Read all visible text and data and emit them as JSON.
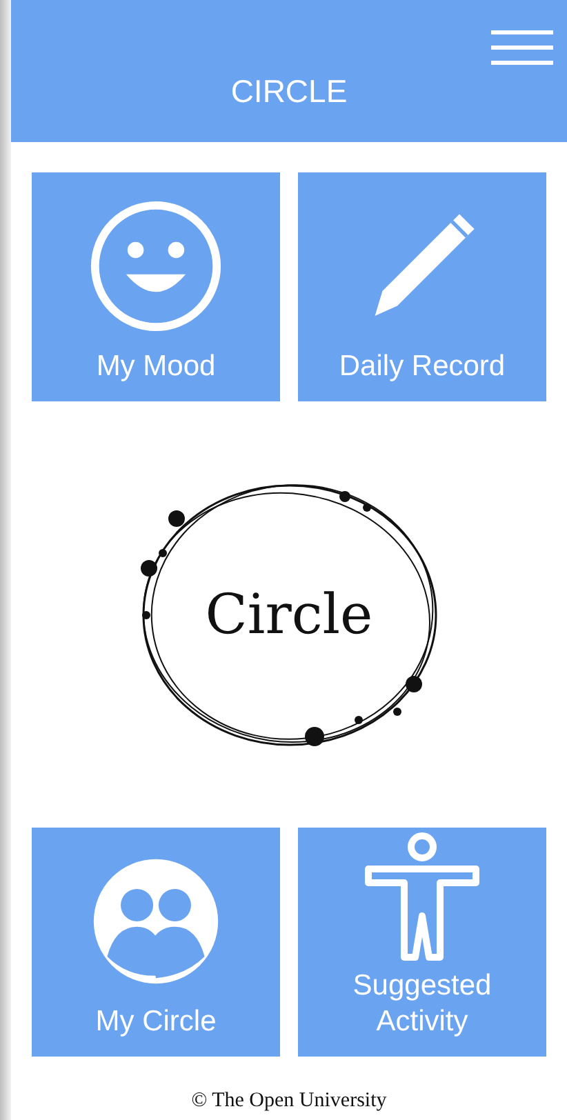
{
  "header": {
    "title": "CIRCLE"
  },
  "tiles_top": [
    {
      "label": "My Mood",
      "kind": "mood"
    },
    {
      "label": "Daily Record",
      "kind": "record"
    }
  ],
  "logo": {
    "text": "Circle"
  },
  "tiles_bottom": [
    {
      "label": "My Circle",
      "kind": "circle"
    },
    {
      "label": "Suggested Activity",
      "kind": "activity"
    }
  ],
  "footer": "© The Open University"
}
